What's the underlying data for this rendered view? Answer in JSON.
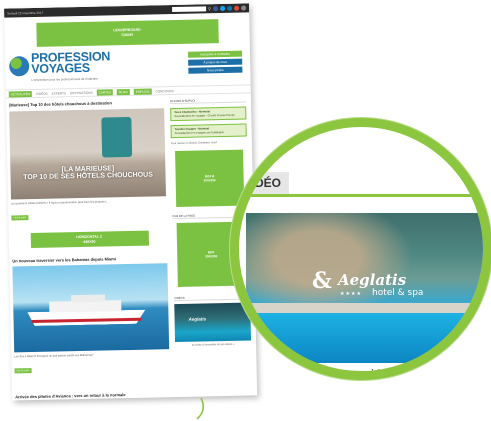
{
  "page": {
    "date": "Samedi 25 novembre 2017",
    "social_colors": [
      "#3b5998",
      "#1da1f2",
      "#0077b5",
      "#dd4b39",
      "#888888"
    ],
    "accent": "#7cc242",
    "brand_blue": "#1d6fa8"
  },
  "leaderboard": {
    "line1": "LEADERBOARD",
    "line2": "728X90"
  },
  "brand": {
    "name_line1": "PROFESSION",
    "name_line2": "VOYAGES",
    "tagline": "L'information pour les professionnels de l'industrie",
    "buttons": [
      "Inscription à l'infolettre",
      "À propos de nous",
      "Nous joindre"
    ]
  },
  "nav": {
    "items": [
      "ACTUALITÉS",
      "VIDÉOS",
      "EXPERTS",
      "DESTINATIONS",
      "CARTES",
      "BLOG",
      "EMPLOIS",
      "CONCOURS"
    ]
  },
  "main": {
    "article1": {
      "title": "[Marieuse] Top 10 des hôtels chouchous à destination",
      "hero_caption_line1": "[LA MARIEUSE]",
      "hero_caption_line2": "TOP 10 DE SES HÔTELS CHOUCHOUS",
      "excerpt": "Les premiers hôtels préférés ! Il faut un questionnaire pour bien les proposer...",
      "more": "Lire la suite"
    },
    "horizontal_ad": {
      "line1": "HORIZONTAL C",
      "line2": "468X60"
    },
    "article2": {
      "title": "Un nouveau traversier vers les Bahamas depuis Miami",
      "excerpt": "Les îles à Miami? Pourquoi ne pas passer plutôt aux Bahamas?",
      "more": "Lire la suite"
    },
    "article3": {
      "title": "Arrivée des pilotes d'Avianca : vers un retour à la normale"
    }
  },
  "sidebar": {
    "jobs_label": "OFFRES D'EMPLOI",
    "jobs": [
      {
        "title": "Tours Chanteclerc - Montréal",
        "desc": "Conseiller(ère) en voyages - Circuits Groupe Europe"
      },
      {
        "title": "Toundra Voyages - Montréal",
        "desc": "Conseiller(ère) en voyages aux Galápagos"
      }
    ],
    "jobs_note": "Pour passer un emploi, Contactez-nous!",
    "box1": {
      "line1": "BOX B",
      "line2": "300X250"
    },
    "box2_label": "PUB DE LA PAGE",
    "box2": {
      "line1": "BOX",
      "line2": "300X250"
    },
    "videos_label": "VIDÉOS",
    "thumb_brand": "Aeglatis",
    "videos_link": "Accédez à l'ensemble de nos vidéos »"
  },
  "zoom": {
    "tab_label": "VIDÉO",
    "logo_icon": "&",
    "logo_name": "Aeglatis",
    "logo_stars": "★★★★",
    "logo_sub": "hotel & spa",
    "caption": "Accédez à l'ensemble de nos vidéos"
  }
}
